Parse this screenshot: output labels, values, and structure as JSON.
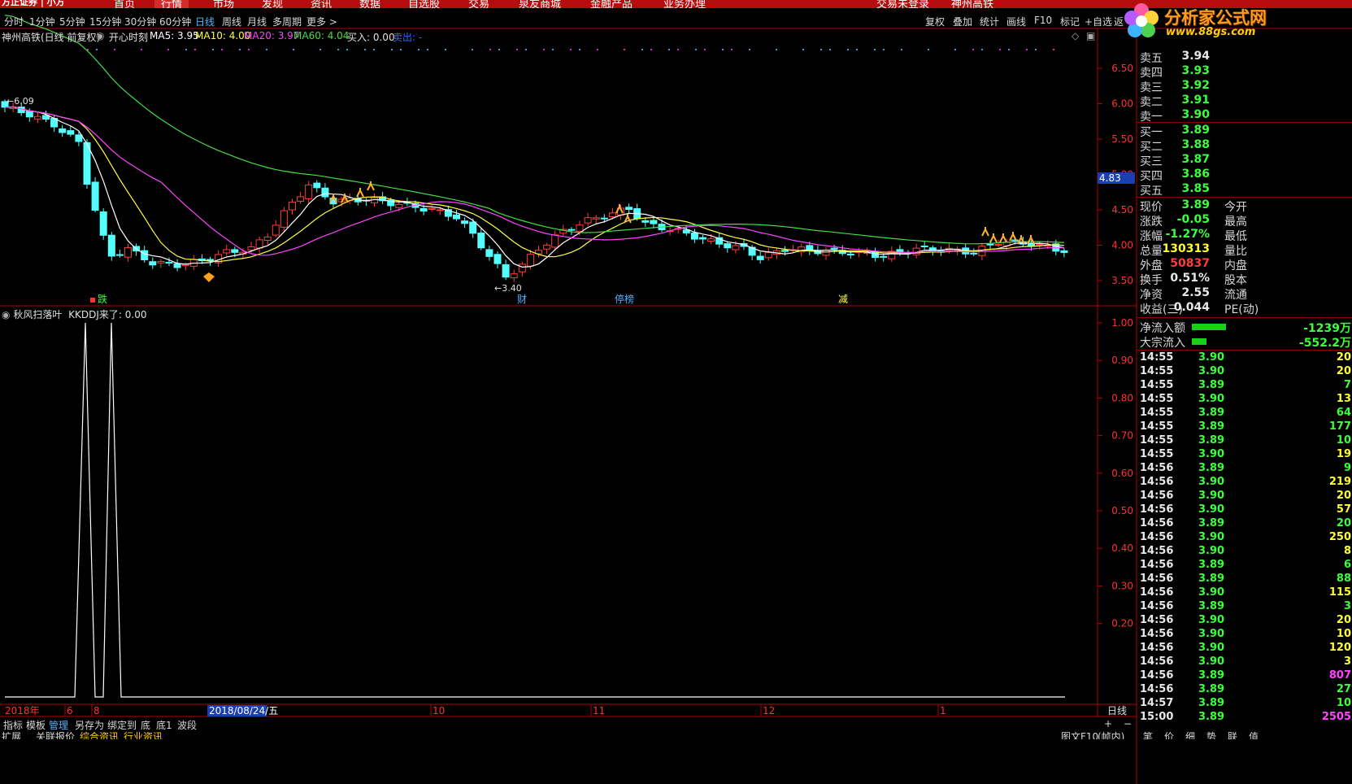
{
  "topbar": {
    "logo": "方正证券 | 小方",
    "menu": [
      "首页",
      "行情",
      "市场",
      "发现",
      "资讯",
      "数据",
      "自选股",
      "交易",
      "泉友商城",
      "金融产品",
      "业务办理"
    ],
    "active_menu": "行情",
    "login_status": "交易未登录",
    "stock_name_top": "神州高铁"
  },
  "brand": {
    "name": "分析家公式网",
    "url": "www.88gs.com"
  },
  "periods": [
    "分时",
    "1分钟",
    "5分钟",
    "15分钟",
    "30分钟",
    "60分钟",
    "日线",
    "周线",
    "月线",
    "多周期",
    "更多 >"
  ],
  "active_period": "日线",
  "tools": [
    "复权",
    "叠加",
    "统计",
    "画线",
    "F10",
    "标记",
    "+自选",
    "返"
  ],
  "infoline": {
    "title": "神州高铁(日线 前复权)",
    "indicator": "开心时刻",
    "ma5": "MA5: 3.95",
    "ma10": "MA10: 4.00",
    "ma20": "MA20: 3.97",
    "ma60": "MA60: 4.04",
    "buy": "买入: 0.00",
    "sell": "卖出: -"
  },
  "colors": {
    "up": "#ff3c3c",
    "down": "#54ffff",
    "ma5": "#ffffff",
    "ma10": "#ffff44",
    "ma20": "#ff44ff",
    "ma60": "#44dd44",
    "axis": "#b00000",
    "green_text": "#3cff3c",
    "yellow_text": "#ffff33",
    "purple_text": "#ff44ff"
  },
  "price_axis": [
    "6.50",
    "6.00",
    "5.50",
    "5.00",
    "4.50",
    "4.00",
    "3.50"
  ],
  "current_price_tag": "4.83",
  "high_label": "6.09",
  "low_label": "3.40",
  "events": [
    "跌",
    "财",
    "停榜",
    "减"
  ],
  "sub_indicator": {
    "title": "秋风扫落叶",
    "value": "KKDDJ来了: 0.00"
  },
  "sub_axis": [
    "1.00",
    "0.90",
    "0.80",
    "0.70",
    "0.60",
    "0.50",
    "0.40",
    "0.30",
    "0.20"
  ],
  "time_axis": {
    "year": "2018年",
    "m6": "6",
    "m8": "8",
    "cursor_date": "2018/08/24/五",
    "m10": "10",
    "m11": "11",
    "m12": "12",
    "m1": "1",
    "period_label": "日线"
  },
  "bottom_tabs": [
    "指标",
    "模板",
    "管理",
    "另存为",
    "绑定到",
    "底",
    "底1",
    "波段"
  ],
  "bottom_active": "管理",
  "bottom2": [
    "扩展",
    "关联报价",
    "综合资讯",
    "行业资讯"
  ],
  "bottom2_right": [
    "图文F10",
    "(帧内)",
    "笔",
    "价",
    "细",
    "势",
    "联",
    "值"
  ],
  "zoom_buttons": [
    "+",
    "−"
  ],
  "quotes_sell": [
    {
      "label": "卖五",
      "price": "3.94"
    },
    {
      "label": "卖四",
      "price": "3.93"
    },
    {
      "label": "卖三",
      "price": "3.92"
    },
    {
      "label": "卖二",
      "price": "3.91"
    },
    {
      "label": "卖一",
      "price": "3.90"
    }
  ],
  "quotes_buy": [
    {
      "label": "买一",
      "price": "3.89"
    },
    {
      "label": "买二",
      "price": "3.88"
    },
    {
      "label": "买三",
      "price": "3.87"
    },
    {
      "label": "买四",
      "price": "3.86"
    },
    {
      "label": "买五",
      "price": "3.85"
    }
  ],
  "stats": [
    {
      "label": "现价",
      "value": "3.89",
      "label2": "今开"
    },
    {
      "label": "涨跌",
      "value": "-0.05",
      "label2": "最高"
    },
    {
      "label": "涨幅",
      "value": "-1.27%",
      "label2": "最低"
    },
    {
      "label": "总量",
      "value": "130313",
      "label2": "量比"
    },
    {
      "label": "外盘",
      "value": "50837",
      "label2": "内盘"
    },
    {
      "label": "换手",
      "value": "0.51%",
      "label2": "股本"
    },
    {
      "label": "净资",
      "value": "2.55",
      "label2": "流通"
    },
    {
      "label": "收益(三)",
      "value": "0.044",
      "label2": "PE(动)"
    }
  ],
  "flows": [
    {
      "label": "净流入额",
      "value": "-1239万"
    },
    {
      "label": "大宗流入",
      "value": "-552.2万"
    }
  ],
  "ticks": [
    {
      "t": "14:55",
      "p": "3.90",
      "v": "20"
    },
    {
      "t": "14:55",
      "p": "3.90",
      "v": "20"
    },
    {
      "t": "14:55",
      "p": "3.89",
      "v": "7"
    },
    {
      "t": "14:55",
      "p": "3.90",
      "v": "13"
    },
    {
      "t": "14:55",
      "p": "3.89",
      "v": "64"
    },
    {
      "t": "14:55",
      "p": "3.89",
      "v": "177"
    },
    {
      "t": "14:55",
      "p": "3.89",
      "v": "10"
    },
    {
      "t": "14:55",
      "p": "3.90",
      "v": "19"
    },
    {
      "t": "14:56",
      "p": "3.89",
      "v": "9"
    },
    {
      "t": "14:56",
      "p": "3.90",
      "v": "219"
    },
    {
      "t": "14:56",
      "p": "3.90",
      "v": "20"
    },
    {
      "t": "14:56",
      "p": "3.90",
      "v": "57"
    },
    {
      "t": "14:56",
      "p": "3.89",
      "v": "20"
    },
    {
      "t": "14:56",
      "p": "3.90",
      "v": "250"
    },
    {
      "t": "14:56",
      "p": "3.90",
      "v": "8"
    },
    {
      "t": "14:56",
      "p": "3.89",
      "v": "6"
    },
    {
      "t": "14:56",
      "p": "3.89",
      "v": "88"
    },
    {
      "t": "14:56",
      "p": "3.90",
      "v": "115"
    },
    {
      "t": "14:56",
      "p": "3.89",
      "v": "3"
    },
    {
      "t": "14:56",
      "p": "3.90",
      "v": "20"
    },
    {
      "t": "14:56",
      "p": "3.90",
      "v": "10"
    },
    {
      "t": "14:56",
      "p": "3.90",
      "v": "120"
    },
    {
      "t": "14:56",
      "p": "3.90",
      "v": "3"
    },
    {
      "t": "14:56",
      "p": "3.89",
      "v": "807"
    },
    {
      "t": "14:56",
      "p": "3.89",
      "v": "27"
    },
    {
      "t": "14:57",
      "p": "3.89",
      "v": "10"
    },
    {
      "t": "15:00",
      "p": "3.89",
      "v": "2505"
    }
  ]
}
